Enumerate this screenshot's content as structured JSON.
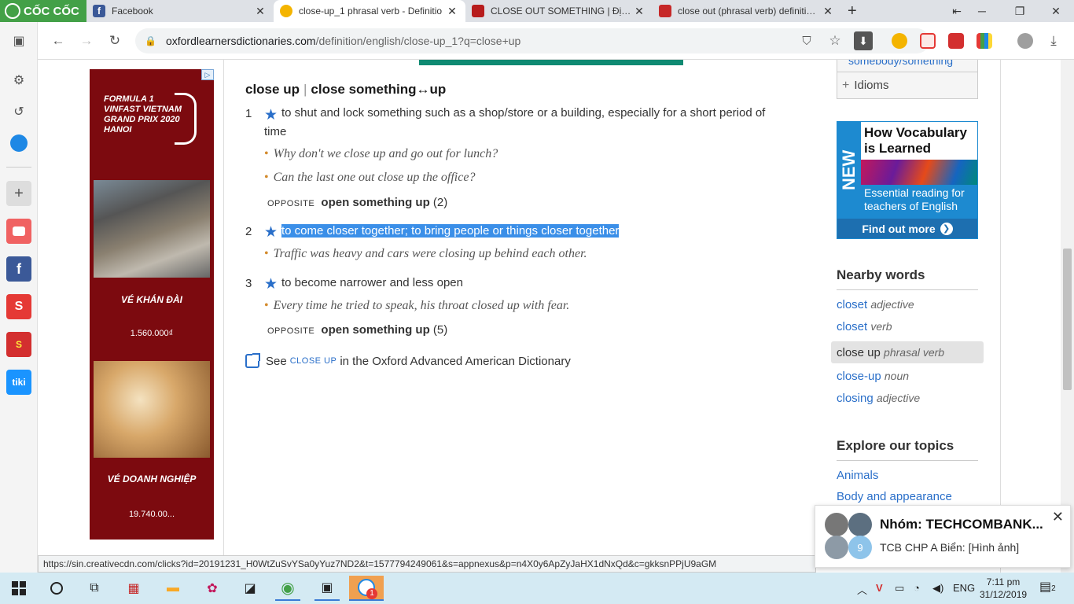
{
  "browser": {
    "brand": "CỐC CỐC",
    "tabs": [
      {
        "title": "Facebook",
        "color": "#3b5998"
      },
      {
        "title": "close-up_1 phrasal verb - Definitio",
        "color": "#f4b400"
      },
      {
        "title": "CLOSE OUT SOMETHING | Định ng",
        "color": "#b71c1c"
      },
      {
        "title": "close out (phrasal verb) definition a",
        "color": "#c62828"
      }
    ],
    "new_tab": "+",
    "url_host": "oxfordlearnersdictionaries.com",
    "url_path": "/definition/english/close-up_1?q=close+up"
  },
  "ad": {
    "badge": "▷",
    "f1_text": "FORMULA 1 VINFAST VIETNAM GRAND PRIX 2020 HANOI",
    "label1": "VÉ KHÁN ĐÀI",
    "price1": "1.560.000₫",
    "label2": "VÉ DOANH NGHIỆP",
    "price2": "19.740.00..."
  },
  "entry": {
    "headword": "close up",
    "variant": "close something↔up",
    "senses": [
      {
        "num": "1",
        "definition": "to shut and lock something such as a shop/store or a building, especially for a short period of",
        "definition_cont": "time",
        "examples": [
          "Why don't we close up and go out for lunch?",
          "Can the last one out close up the office?"
        ],
        "opposite_label": "OPPOSITE",
        "opposite_word": "open something up",
        "opposite_num": "(2)"
      },
      {
        "num": "2",
        "definition": "to come closer together; to bring people or things closer together",
        "examples": [
          "Traffic was heavy and cars were closing up behind each other."
        ]
      },
      {
        "num": "3",
        "definition": "to become narrower and less open",
        "examples": [
          "Every time he tried to speak, his throat closed up with fear."
        ],
        "opposite_label": "OPPOSITE",
        "opposite_word": "open something up",
        "opposite_num": "(5)"
      }
    ],
    "see_prefix": "See",
    "see_link": "CLOSE UP",
    "see_suffix": "in the Oxford Advanced American Dictionary"
  },
  "sidebar_right": {
    "prev_item": "somebody/something",
    "idioms": "Idioms",
    "promo": {
      "new": "NEW",
      "title": "How Vocabulary is Learned",
      "subtitle": "Essential reading for teachers of English",
      "button": "Find out more"
    },
    "nearby_title": "Nearby words",
    "nearby": [
      {
        "word": "closet",
        "pos": "adjective"
      },
      {
        "word": "closet",
        "pos": "verb"
      },
      {
        "word": "close up",
        "pos": "phrasal verb"
      },
      {
        "word": "close-up",
        "pos": "noun"
      },
      {
        "word": "closing",
        "pos": "adjective"
      }
    ],
    "topics_title": "Explore our topics",
    "topics": [
      "Animals",
      "Body and appearance"
    ]
  },
  "status_url": "https://sin.creativecdn.com/clicks?id=20191231_H0WtZuSvYSa0yYuz7ND2&t=1577794249061&s=appnexus&p=n4X0y6ApZyJaHX1dNxQd&c=gkksnPPjU9aGM",
  "notification": {
    "count": "9",
    "title": "Nhóm: TECHCOMBANK...",
    "message": "TCB CHP A Biển: [Hình ảnh]"
  },
  "taskbar": {
    "language": "ENG",
    "time": "7:11 pm",
    "date": "31/12/2019",
    "notif_count": "2",
    "zalo_badge": "1"
  }
}
